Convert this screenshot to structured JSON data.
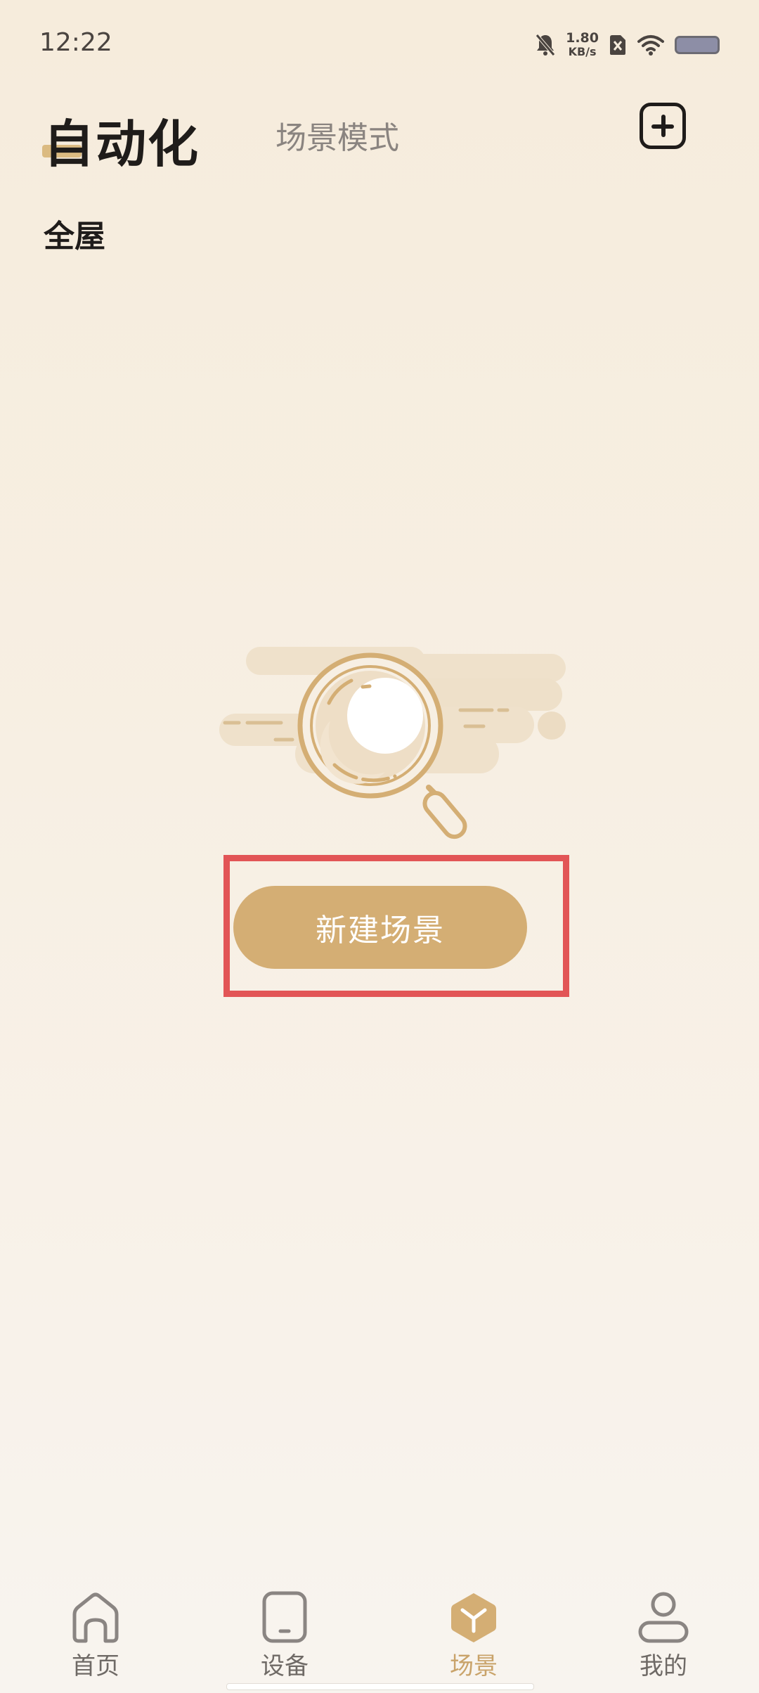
{
  "status_bar": {
    "time": "12:22",
    "speed_value": "1.80",
    "speed_unit": "KB/s",
    "icons": [
      "bell-muted-icon",
      "no-sim-icon",
      "wifi-icon",
      "battery-icon"
    ]
  },
  "header": {
    "title": "自动化",
    "secondary_tab": "场景模式",
    "add_icon": "plus-square-icon"
  },
  "section": {
    "label": "全屋"
  },
  "empty_state": {
    "illustration": "magnifier-empty-icon",
    "button_label": "新建场景"
  },
  "bottom_nav": {
    "items": [
      {
        "label": "首页",
        "icon": "home-icon"
      },
      {
        "label": "设备",
        "icon": "device-icon"
      },
      {
        "label": "场景",
        "icon": "scene-icon",
        "active": true
      },
      {
        "label": "我的",
        "icon": "profile-icon"
      }
    ]
  },
  "colors": {
    "accent": "#d4ae74",
    "active_tab": "#c9a36a",
    "highlight": "#e25556",
    "background": "#f6ecdc"
  }
}
